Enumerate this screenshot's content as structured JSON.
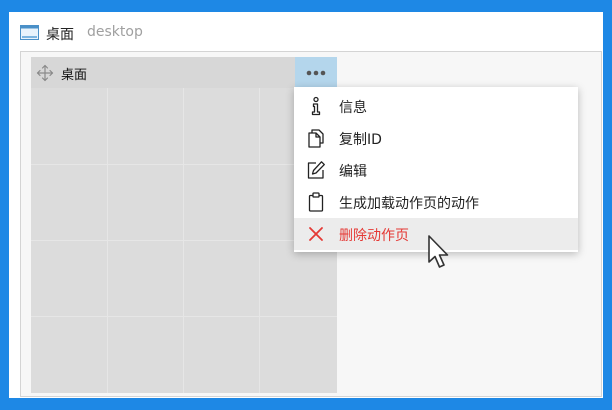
{
  "window": {
    "title": "桌面",
    "subtitle": "desktop",
    "app_icon": "window-icon"
  },
  "panel": {
    "title": "桌面",
    "move_icon": "move-icon",
    "more_icon": "more-dots-icon"
  },
  "menu": {
    "items": [
      {
        "label": "信息",
        "icon": "info-icon"
      },
      {
        "label": "复制ID",
        "icon": "copy-icon"
      },
      {
        "label": "编辑",
        "icon": "edit-icon"
      },
      {
        "label": "生成加载动作页的动作",
        "icon": "clipboard-icon"
      },
      {
        "label": "删除动作页",
        "icon": "close-icon",
        "color": "#e53935"
      }
    ]
  },
  "colors": {
    "frame": "#1e88e5",
    "more_button_bg": "#b4d6ec",
    "danger": "#e53935"
  }
}
